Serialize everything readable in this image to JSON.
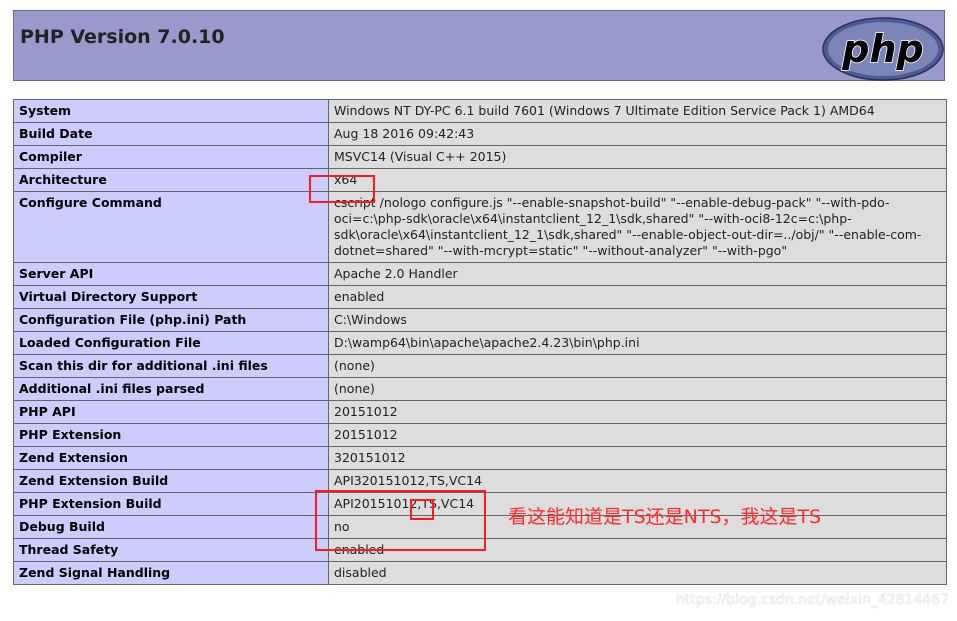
{
  "header": {
    "title": "PHP Version 7.0.10",
    "logo_text": "php"
  },
  "rows": [
    {
      "key": "System",
      "value": "Windows NT DY-PC 6.1 build 7601 (Windows 7 Ultimate Edition Service Pack 1) AMD64"
    },
    {
      "key": "Build Date",
      "value": "Aug 18 2016 09:42:43"
    },
    {
      "key": "Compiler",
      "value": "MSVC14 (Visual C++ 2015)"
    },
    {
      "key": "Architecture",
      "value": "x64"
    },
    {
      "key": "Configure Command",
      "value": "cscript /nologo configure.js \"--enable-snapshot-build\" \"--enable-debug-pack\" \"--with-pdo-oci=c:\\php-sdk\\oracle\\x64\\instantclient_12_1\\sdk,shared\" \"--with-oci8-12c=c:\\php-sdk\\oracle\\x64\\instantclient_12_1\\sdk,shared\" \"--enable-object-out-dir=../obj/\" \"--enable-com-dotnet=shared\" \"--with-mcrypt=static\" \"--without-analyzer\" \"--with-pgo\""
    },
    {
      "key": "Server API",
      "value": "Apache 2.0 Handler"
    },
    {
      "key": "Virtual Directory Support",
      "value": "enabled"
    },
    {
      "key": "Configuration File (php.ini) Path",
      "value": "C:\\Windows"
    },
    {
      "key": "Loaded Configuration File",
      "value": "D:\\wamp64\\bin\\apache\\apache2.4.23\\bin\\php.ini"
    },
    {
      "key": "Scan this dir for additional .ini files",
      "value": "(none)"
    },
    {
      "key": "Additional .ini files parsed",
      "value": "(none)"
    },
    {
      "key": "PHP API",
      "value": "20151012"
    },
    {
      "key": "PHP Extension",
      "value": "20151012"
    },
    {
      "key": "Zend Extension",
      "value": "320151012"
    },
    {
      "key": "Zend Extension Build",
      "value": "API320151012,TS,VC14"
    },
    {
      "key": "PHP Extension Build",
      "value": "API20151012,TS,VC14"
    },
    {
      "key": "Debug Build",
      "value": "no"
    },
    {
      "key": "Thread Safety",
      "value": "enabled"
    },
    {
      "key": "Zend Signal Handling",
      "value": "disabled"
    }
  ],
  "annotation": "看这能知道是TS还是NTS，我这是TS",
  "watermark": "https://blog.csdn.net/weixin_42814467",
  "colors": {
    "header_bg": "#9999cc",
    "key_bg": "#ccccff",
    "value_bg": "#dddddd",
    "highlight": "#ff1a1a"
  }
}
